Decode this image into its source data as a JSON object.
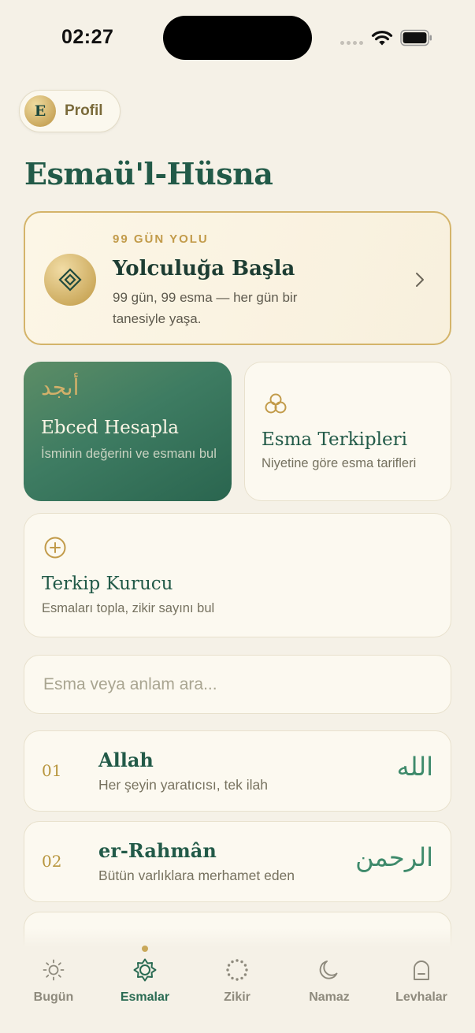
{
  "status_bar": {
    "time": "02:27"
  },
  "profile": {
    "initial": "E",
    "label": "Profil"
  },
  "page_title": "Esmaü'l-Hüsna",
  "journey": {
    "eyebrow": "99 GÜN YOLU",
    "title": "Yolculuğa Başla",
    "description": "99 gün, 99 esma — her gün bir tanesiyle yaşa."
  },
  "ebced": {
    "arabic": "أبجد",
    "title": "Ebced Hesapla",
    "description": "İsminin değerini ve esmanı bul"
  },
  "terkip": {
    "title": "Esma Terkipleri",
    "description": "Niyetine göre esma tarifleri"
  },
  "builder": {
    "title": "Terkip Kurucu",
    "description": "Esmaları topla, zikir sayını bul"
  },
  "search": {
    "placeholder": "Esma veya anlam ara..."
  },
  "names": [
    {
      "number": "01",
      "name": "Allah",
      "meaning": "Her şeyin yaratıcısı, tek ilah",
      "arabic": "الله"
    },
    {
      "number": "02",
      "name": "er-Rahmân",
      "meaning": "Bütün varlıklara merhamet eden",
      "arabic": "الرحمن"
    }
  ],
  "nav": {
    "items": [
      {
        "label": "Bugün",
        "icon": "sun-icon"
      },
      {
        "label": "Esmalar",
        "icon": "star-icon",
        "active": true
      },
      {
        "label": "Zikir",
        "icon": "prayer-beads-icon"
      },
      {
        "label": "Namaz",
        "icon": "moon-icon"
      },
      {
        "label": "Levhalar",
        "icon": "arch-icon"
      }
    ]
  },
  "colors": {
    "background": "#f5f1e7",
    "primary_green": "#225a48",
    "gold": "#c9a85a",
    "card": "#fcf9f0"
  }
}
